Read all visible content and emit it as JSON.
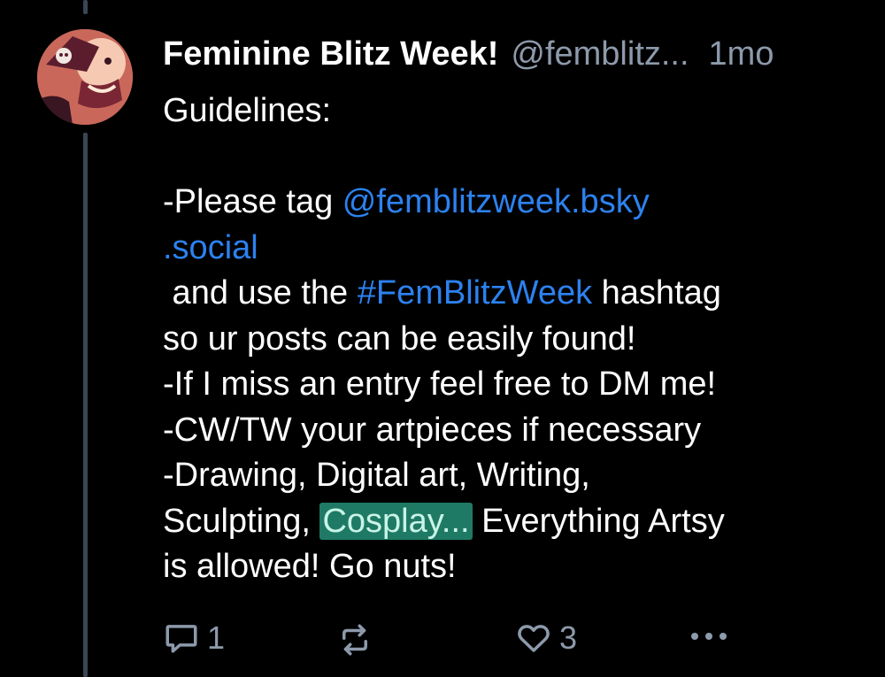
{
  "post": {
    "author": {
      "display_name": "Feminine Blitz Week!",
      "handle": "@femblitz...",
      "time": "1mo"
    },
    "body_lines": [
      {
        "parts": [
          {
            "t": "Guidelines:"
          }
        ]
      },
      {
        "parts": [
          {
            "t": ""
          }
        ]
      },
      {
        "parts": [
          {
            "t": "-Please tag "
          },
          {
            "t": "@femblitzweek.bsky",
            "kind": "link"
          }
        ]
      },
      {
        "parts": [
          {
            "t": ".social",
            "kind": "link"
          }
        ]
      },
      {
        "parts": [
          {
            "t": " and use the "
          },
          {
            "t": "#FemBlitzWeek",
            "kind": "link"
          },
          {
            "t": " hashtag"
          }
        ]
      },
      {
        "parts": [
          {
            "t": "so ur posts can be easily found!"
          }
        ]
      },
      {
        "parts": [
          {
            "t": "-If I miss an entry feel free to DM me!"
          }
        ]
      },
      {
        "parts": [
          {
            "t": "-CW/TW your artpieces if necessary"
          }
        ]
      },
      {
        "parts": [
          {
            "t": "-Drawing, Digital art, Writing,"
          }
        ]
      },
      {
        "parts": [
          {
            "t": "Sculpting, "
          },
          {
            "t": "Cosplay...",
            "kind": "highlight"
          },
          {
            "t": " Everything Artsy"
          }
        ]
      },
      {
        "parts": [
          {
            "t": "is allowed! Go nuts!"
          }
        ]
      }
    ],
    "actions": {
      "reply_count": "1",
      "like_count": "3"
    }
  },
  "icons": {
    "reply": "reply-bubble-icon",
    "repost": "repost-arrows-icon",
    "like": "heart-icon",
    "more": "more-dots-icon"
  },
  "colors": {
    "background": "#000000",
    "text": "#ffffff",
    "muted": "#8d9aab",
    "link": "#2c82f0",
    "highlight": "#1f7a65",
    "thread_line": "#3a4655"
  }
}
